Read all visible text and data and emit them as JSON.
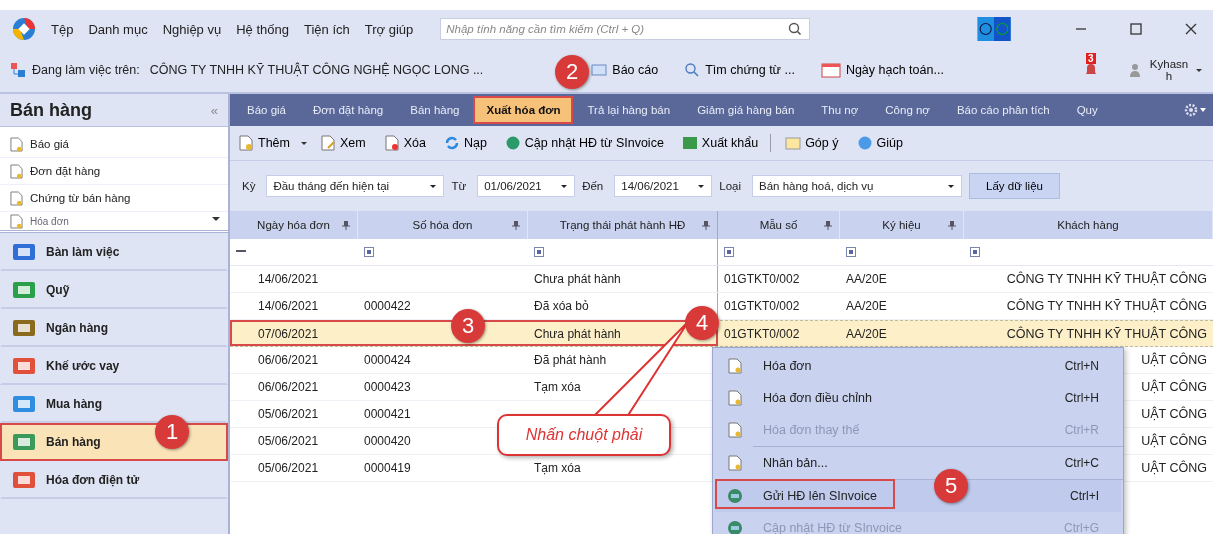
{
  "menu_bar": {
    "items": [
      "Tệp",
      "Danh mục",
      "Nghiệp vụ",
      "Hệ thống",
      "Tiện ích",
      "Trợ giúp"
    ],
    "search": {
      "placeholder": "Nhập tính năng cần tìm kiếm (Ctrl + Q)"
    }
  },
  "info_bar": {
    "label": "Đang làm việc trên:",
    "company": "CÔNG TY TNHH KỸ THUẬT CÔNG NGHỆ NGỌC LONG ...",
    "actions": [
      "Báo cáo",
      "Tìm chứng từ ...",
      "Ngày hạch toán..."
    ],
    "notification_count": "3",
    "user": "Kyhasnh"
  },
  "sidebar": {
    "title": "Bán hàng",
    "collapse": "«",
    "items": [
      "Báo giá",
      "Đơn đặt hàng",
      "Chứng từ bán hàng",
      "Hóa đơn"
    ],
    "modules": [
      {
        "label": "Bàn làm việc",
        "selected": false
      },
      {
        "label": "Quỹ",
        "selected": false
      },
      {
        "label": "Ngân hàng",
        "selected": false
      },
      {
        "label": "Khế ước vay",
        "selected": false
      },
      {
        "label": "Mua hàng",
        "selected": false
      },
      {
        "label": "Bán hàng",
        "selected": true
      },
      {
        "label": "Hóa đơn điện tử",
        "selected": false
      }
    ]
  },
  "tabs": [
    {
      "label": "Báo giá",
      "selected": false
    },
    {
      "label": "Đơn đặt hàng",
      "selected": false
    },
    {
      "label": "Bán hàng",
      "selected": false
    },
    {
      "label": "Xuất hóa đơn",
      "selected": true
    },
    {
      "label": "Trả lại hàng bán",
      "selected": false
    },
    {
      "label": "Giảm giá hàng bán",
      "selected": false
    },
    {
      "label": "Thu nợ",
      "selected": false
    },
    {
      "label": "Công nợ",
      "selected": false
    },
    {
      "label": "Báo cáo phân tích",
      "selected": false
    },
    {
      "label": "Quy",
      "selected": false
    }
  ],
  "toolbar": [
    "Thêm",
    "Xem",
    "Xóa",
    "Nạp",
    "Cập nhật HĐ từ SInvoice",
    "Xuất khẩu",
    "Góp ý",
    "Giúp"
  ],
  "filters": {
    "period_label": "Kỳ",
    "period": "Đầu tháng đến hiện tại",
    "from_label": "Từ",
    "from": "01/06/2021",
    "to_label": "Đến",
    "to": "14/06/2021",
    "type_label": "Loại",
    "type": "Bán hàng hoá, dịch vụ",
    "fetch_button": "Lấy dữ liệu"
  },
  "table": {
    "columns": [
      "Ngày hóa đơn",
      "Số hóa đơn",
      "Trạng thái phát hành HĐ",
      "Mẫu số",
      "Ký hiệu",
      "Khách hàng"
    ],
    "rows": [
      {
        "date": "14/06/2021",
        "status": "Chưa phát hành",
        "template": "01GTKT0/002",
        "symbol": "AA/20E",
        "customer": "CÔNG TY TNHH KỸ THUẬT CÔNG",
        "selected": false
      },
      {
        "date": "14/06/2021",
        "number": "0000422",
        "status": "Đã xóa bỏ",
        "template": "01GTKT0/002",
        "symbol": "AA/20E",
        "customer": "CÔNG TY TNHH KỸ THUẬT CÔNG",
        "selected": false
      },
      {
        "date": "07/06/2021",
        "status": "Chưa phát hành",
        "template": "01GTKT0/002",
        "symbol": "AA/20E",
        "customer": "CÔNG TY TNHH KỸ THUẬT CÔNG",
        "selected": true
      },
      {
        "date": "06/06/2021",
        "number": "0000424",
        "status": "Đã phát hành",
        "customer": "UẬT CÔNG",
        "selected": false
      },
      {
        "date": "06/06/2021",
        "number": "0000423",
        "status": "Tạm xóa",
        "customer": "UẬT CÔNG",
        "selected": false
      },
      {
        "date": "05/06/2021",
        "number": "0000421",
        "customer": "UẬT CÔNG",
        "selected": false
      },
      {
        "date": "05/06/2021",
        "number": "0000420",
        "customer": "UẬT CÔNG",
        "selected": false
      },
      {
        "date": "05/06/2021",
        "number": "0000419",
        "status": "Tạm xóa",
        "customer": "UẬT CÔNG",
        "selected": false
      }
    ]
  },
  "context_menu": [
    {
      "label": "Hóa đơn",
      "shortcut": "Ctrl+N",
      "disabled": false,
      "highlighted": false
    },
    {
      "label": "Hóa đơn điều chỉnh",
      "shortcut": "Ctrl+H",
      "disabled": false,
      "highlighted": false
    },
    {
      "label": "Hóa đơn thay thế",
      "shortcut": "Ctrl+R",
      "disabled": true,
      "highlighted": false
    },
    {
      "label": "Nhân bản...",
      "shortcut": "Ctrl+C",
      "disabled": false,
      "highlighted": false
    },
    {
      "label": "Gửi HĐ lên SInvoice",
      "shortcut": "Ctrl+I",
      "disabled": false,
      "highlighted": true
    },
    {
      "label": "Cập nhật HĐ từ SInvoice",
      "shortcut": "Ctrl+G",
      "disabled": true,
      "highlighted": false
    }
  ],
  "annotations": {
    "markers": [
      "1",
      "2",
      "3",
      "4",
      "5"
    ],
    "callout": "Nhấn chuột phải"
  }
}
